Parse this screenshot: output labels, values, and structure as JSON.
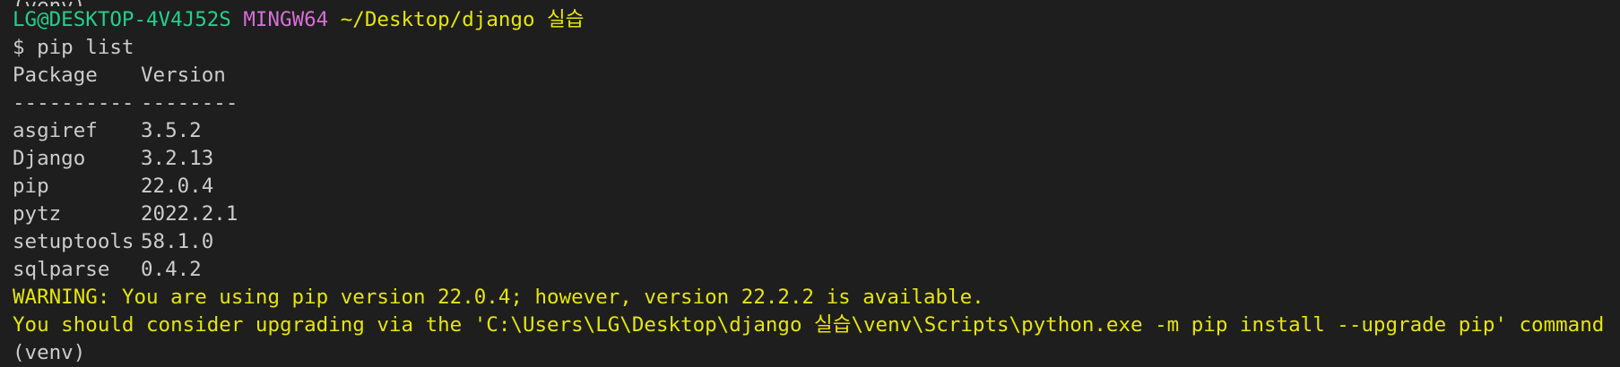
{
  "terminal": {
    "prompt": {
      "user_host": "LG@DESKTOP-4V4J52S",
      "system": "MINGW64",
      "path": "~/Desktop/django 실습"
    },
    "command_prompt_symbol": "$",
    "command": "pip list",
    "header": {
      "package": "Package",
      "version": "Version"
    },
    "separator": {
      "package": "----------",
      "version": "--------"
    },
    "packages": [
      {
        "name": "asgiref",
        "version": "3.5.2"
      },
      {
        "name": "Django",
        "version": "3.2.13"
      },
      {
        "name": "pip",
        "version": "22.0.4"
      },
      {
        "name": "pytz",
        "version": "2022.2.1"
      },
      {
        "name": "setuptools",
        "version": "58.1.0"
      },
      {
        "name": "sqlparse",
        "version": "0.4.2"
      }
    ],
    "warning_line_1": "WARNING: You are using pip version 22.0.4; however, version 22.2.2 is available.",
    "warning_line_2": "You should consider upgrading via the 'C:\\Users\\LG\\Desktop\\django 실습\\venv\\Scripts\\python.exe -m pip install --upgrade pip' command.",
    "venv_indicator": "(venv)"
  },
  "colors": {
    "background": "#1e1e1e",
    "default_text": "#cccccc",
    "user_host": "#23d18b",
    "system": "#d670d6",
    "path": "#e5e510",
    "warning": "#e5e510"
  }
}
